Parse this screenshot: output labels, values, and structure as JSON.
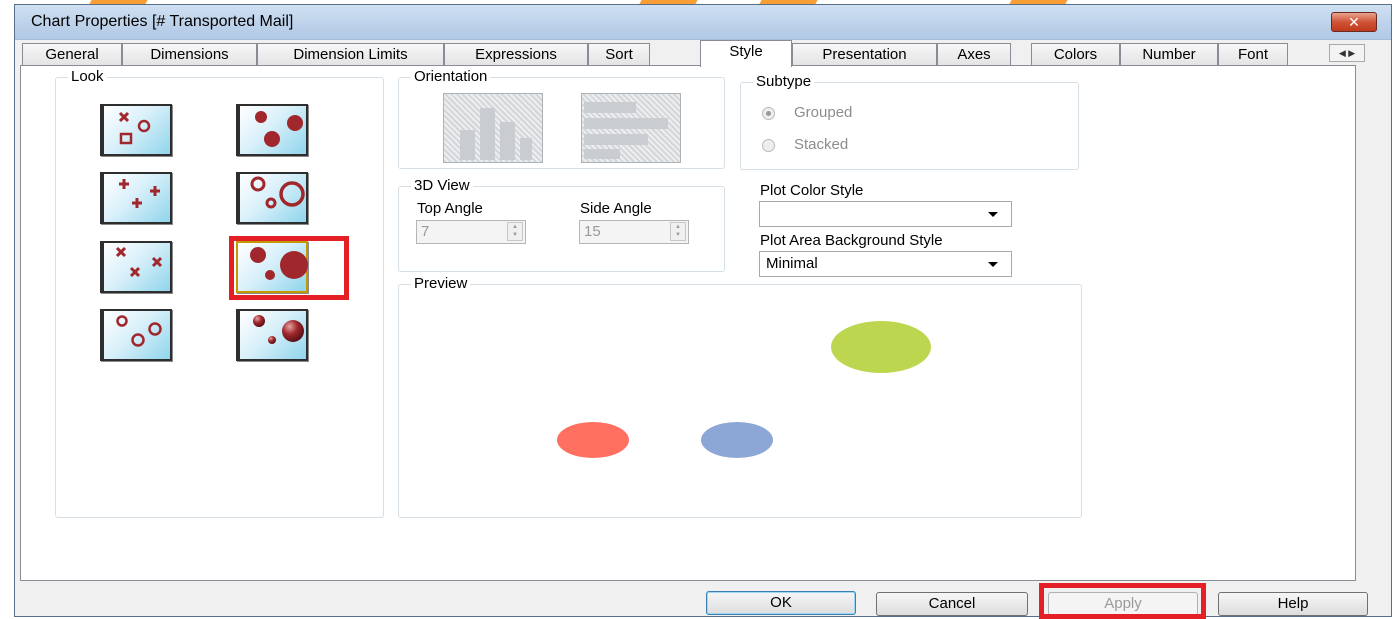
{
  "window": {
    "title": "Chart Properties [# Transported Mail]",
    "close_icon": "close-icon"
  },
  "tabs": [
    {
      "label": "General"
    },
    {
      "label": "Dimensions"
    },
    {
      "label": "Dimension Limits"
    },
    {
      "label": "Expressions"
    },
    {
      "label": "Sort"
    },
    {
      "label": "Style",
      "active": true
    },
    {
      "label": "Presentation"
    },
    {
      "label": "Axes"
    },
    {
      "label": "Colors"
    },
    {
      "label": "Number"
    },
    {
      "label": "Font"
    }
  ],
  "look": {
    "legend": "Look",
    "styles": [
      {
        "name": "cross-circle-square-icon"
      },
      {
        "name": "solid-dots-icon"
      },
      {
        "name": "plus-markers-icon"
      },
      {
        "name": "hollow-circles-icon"
      },
      {
        "name": "cross-markers-icon"
      },
      {
        "name": "solid-bubbles-icon",
        "selected": true
      },
      {
        "name": "small-hollow-circles-icon"
      },
      {
        "name": "shaded-spheres-icon"
      }
    ]
  },
  "orientation": {
    "legend": "Orientation"
  },
  "subtype": {
    "legend": "Subtype",
    "grouped": "Grouped",
    "stacked": "Stacked",
    "selected": "Grouped"
  },
  "view3d": {
    "legend": "3D View",
    "top_angle_label": "Top Angle",
    "top_angle_value": "7",
    "side_angle_label": "Side Angle",
    "side_angle_value": "15"
  },
  "plot_color_style": {
    "label": "Plot Color Style",
    "value": ""
  },
  "plot_area_bg": {
    "label": "Plot Area Background Style",
    "value": "Minimal"
  },
  "preview": {
    "legend": "Preview",
    "bubble_colors": [
      "#ff7061",
      "#8ca6d6",
      "#bdd64f"
    ]
  },
  "buttons": {
    "ok": "OK",
    "cancel": "Cancel",
    "apply": "Apply",
    "help": "Help"
  },
  "colors": {
    "highlight": "#e41f26",
    "marker": "#a0282d"
  }
}
